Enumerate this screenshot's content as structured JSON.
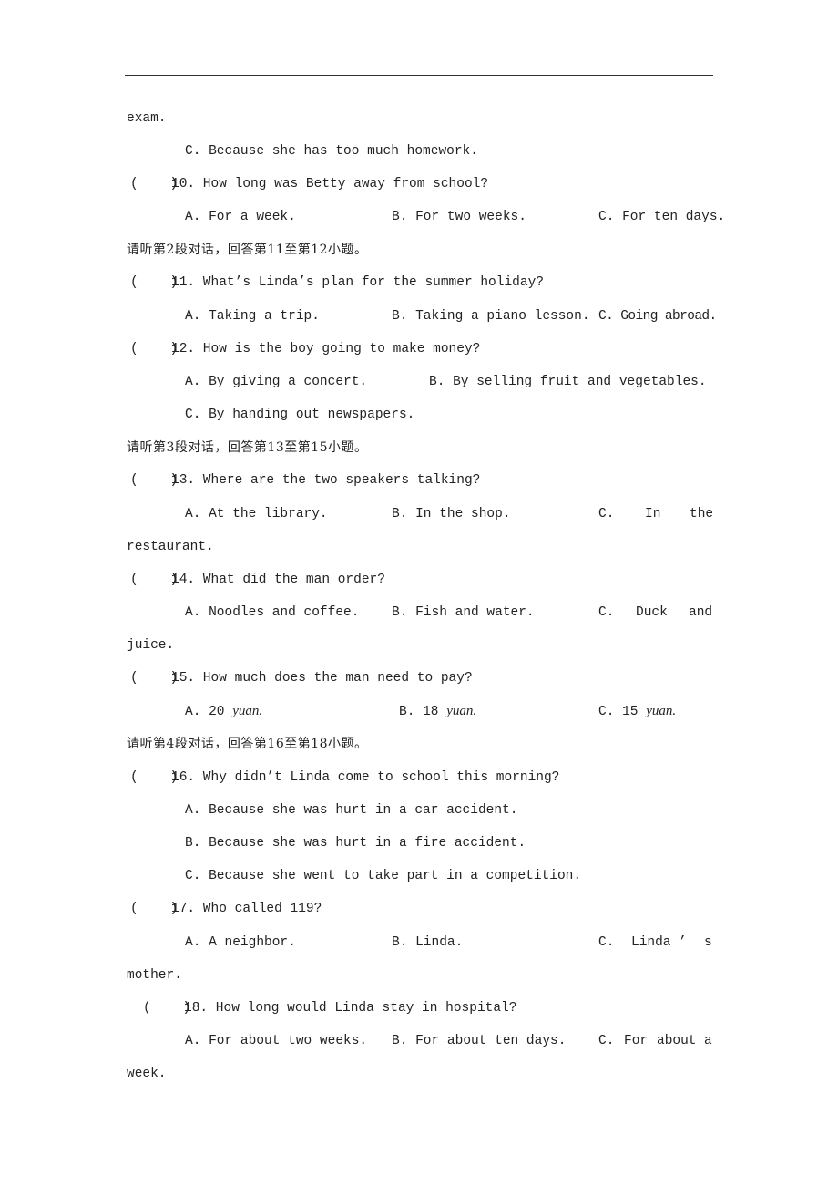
{
  "page": {
    "continuation_text": "exam.",
    "q9_option_c": "C. Because she has too much homework.",
    "sections": [
      {
        "instruction": "请听第2段对话，回答第11至第12小题。"
      },
      {
        "instruction": "请听第3段对话，回答第13至第15小题。"
      },
      {
        "instruction": "请听第4段对话，回答第16至第18小题。"
      }
    ],
    "questions": {
      "q10": {
        "paren": "(    )",
        "stem": "10. How long was Betty away from school?",
        "a": "A. For a week.",
        "b": "B. For two weeks.",
        "c": "C. For ten days."
      },
      "q11": {
        "paren": "(    )",
        "stem": "11. What’s Linda’s plan for the summer holiday?",
        "a": "A. Taking a trip.",
        "b": "B. Taking a piano lesson.",
        "c": "C. Going abroad."
      },
      "q12": {
        "paren": "(    )",
        "stem": "12. How is the boy going to make money?",
        "a": "A. By giving a concert.",
        "b": "B. By selling fruit and vegetables.",
        "c": "C. By handing out newspapers."
      },
      "q13": {
        "paren": "(    )",
        "stem": "13. Where are the two speakers talking?",
        "a": "A. At the library.",
        "b": "B. In the shop.",
        "c_label": "C.",
        "c_word1": "In",
        "c_word2": "the",
        "c_cont": "restaurant."
      },
      "q14": {
        "paren": "(    )",
        "stem": "14. What did the man order?",
        "a": "A. Noodles and coffee.",
        "b": "B. Fish and water.",
        "c_label": "C.",
        "c_word1": "Duck",
        "c_word2": "and",
        "c_cont": "juice."
      },
      "q15": {
        "paren": "(    )",
        "stem": "15. How much does the man need to pay?",
        "a_label": "A. 20",
        "b_label": "B. 18",
        "c_label": "C. 15",
        "unit": "yuan."
      },
      "q16": {
        "paren": "(    )",
        "stem": "16. Why didn’t Linda come to school this morning?",
        "a": "A. Because she was hurt in a car accident.",
        "b": "B. Because she was hurt in a fire accident.",
        "c": "C. Because she went to take part in a competition."
      },
      "q17": {
        "paren": "(    )",
        "stem": "17. Who called 119?",
        "a": "A. A neighbor.",
        "b": "B. Linda.",
        "c_label": "C.",
        "c_word1": "Linda",
        "c_word2": "’",
        "c_word3": "s",
        "c_cont": "mother."
      },
      "q18": {
        "paren": "(    )",
        "stem": "18. How long would Linda stay in hospital?",
        "a": "A. For about two weeks.",
        "b": "B. For about ten days.",
        "c_label": "C.",
        "c_word1": "For",
        "c_word2": "about",
        "c_word3": "a",
        "c_cont": "week."
      }
    }
  }
}
